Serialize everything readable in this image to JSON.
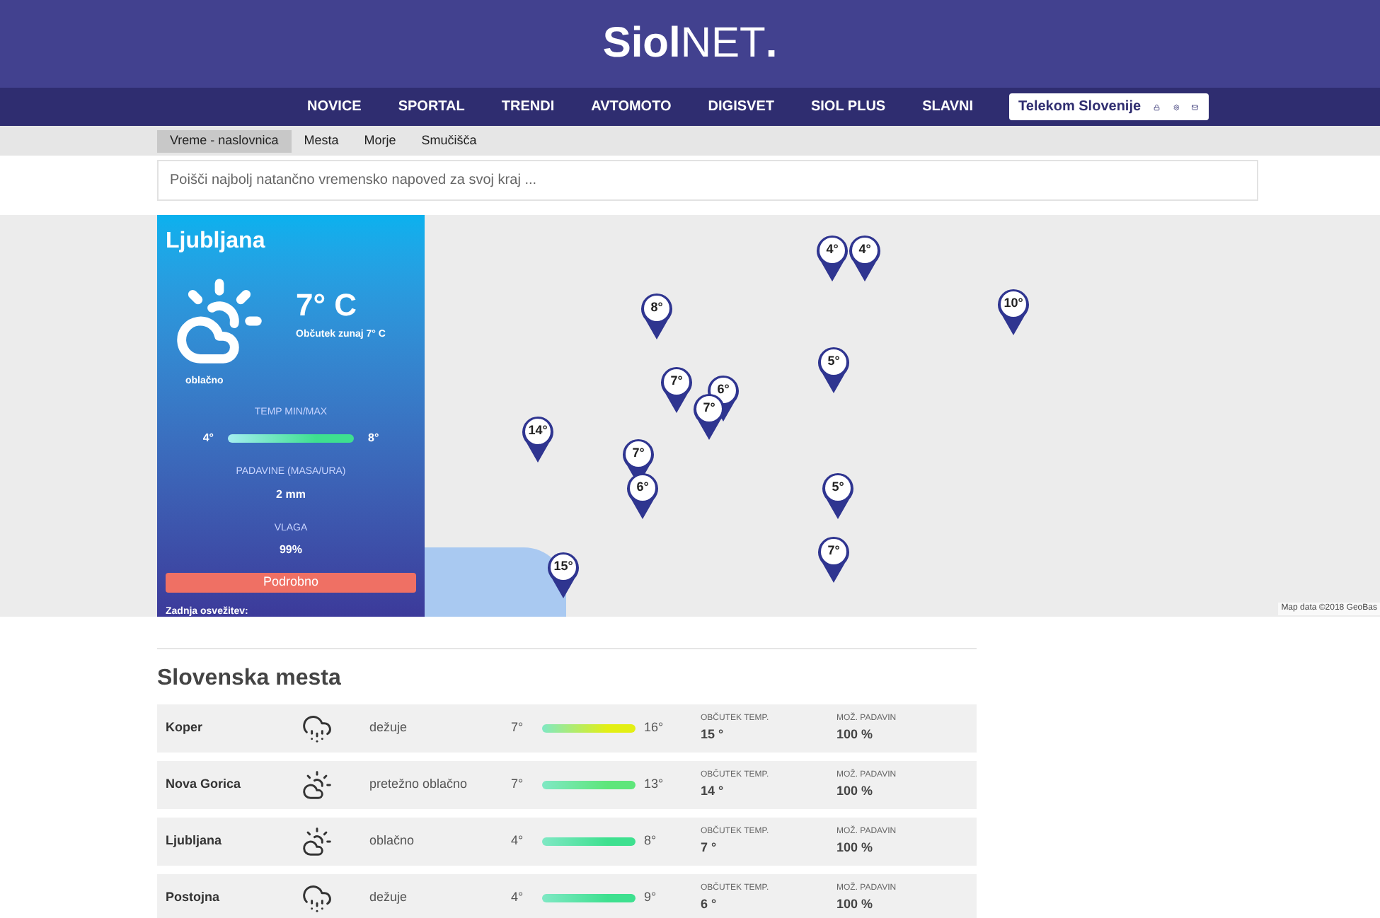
{
  "logo": {
    "bold": "Siol",
    "light": "NET",
    "dot": "."
  },
  "nav": [
    "NOVICE",
    "SPORTAL",
    "TRENDI",
    "AVTOMOTO",
    "DIGISVET",
    "SIOL PLUS",
    "SLAVNI"
  ],
  "account": {
    "label": "Telekom Slovenije"
  },
  "tabs": [
    {
      "label": "Vreme - naslovnica",
      "selected": true
    },
    {
      "label": "Mesta",
      "selected": false
    },
    {
      "label": "Morje",
      "selected": false
    },
    {
      "label": "Smučišča",
      "selected": false
    }
  ],
  "search": {
    "placeholder": "Poišči najbolj natančno vremensko napoved za svoj kraj ..."
  },
  "current": {
    "city": "Ljubljana",
    "temp": "7° C",
    "feels": "Občutek zunaj 7° C",
    "condition": "oblačno",
    "minmax_label": "TEMP MIN/MAX",
    "min": "4°",
    "max": "8°",
    "color": "#3ee08f",
    "rain_label": "PADAVINE (MASA/URA)",
    "rain": "2 mm",
    "humidity_label": "VLAGA",
    "humidity": "99%",
    "button": "Podrobno",
    "updated": "Zadnja osvežitev:"
  },
  "map": {
    "pins": [
      {
        "label": "4°"
      },
      {
        "label": "4°"
      },
      {
        "label": "8°"
      },
      {
        "label": "10°"
      },
      {
        "label": "5°"
      },
      {
        "label": "7°"
      },
      {
        "label": "6°"
      },
      {
        "label": "7°"
      },
      {
        "label": "14°"
      },
      {
        "label": "7°"
      },
      {
        "label": "6°"
      },
      {
        "label": "5°"
      },
      {
        "label": "7°"
      },
      {
        "label": "15°"
      }
    ],
    "attribution": "Map data ©2018 GeoBas"
  },
  "cities": {
    "title": "Slovenska mesta",
    "rows": [
      {
        "name": "Koper",
        "kind": "rain",
        "condition": "dežuje",
        "min": "7°",
        "max": "16°",
        "color": "#e3ef14",
        "feels_label": "OBČUTEK TEMP.",
        "feels": "15 °",
        "rain_label": "MOŽ. PADAVIN",
        "rain": "100 %"
      },
      {
        "name": "Nova Gorica",
        "kind": "partly_cloudy",
        "condition": "pretežno oblačno",
        "min": "7°",
        "max": "13°",
        "color": "#5ee67a",
        "feels_label": "OBČUTEK TEMP.",
        "feels": "14 °",
        "rain_label": "MOŽ. PADAVIN",
        "rain": "100 %"
      },
      {
        "name": "Ljubljana",
        "kind": "partly_cloudy",
        "condition": "oblačno",
        "min": "4°",
        "max": "8°",
        "color": "#3ee08f",
        "feels_label": "OBČUTEK TEMP.",
        "feels": "7 °",
        "rain_label": "MOŽ. PADAVIN",
        "rain": "100 %"
      },
      {
        "name": "Postojna",
        "kind": "rain",
        "condition": "dežuje",
        "min": "4°",
        "max": "9°",
        "color": "#3ee08f",
        "feels_label": "OBČUTEK TEMP.",
        "feels": "6 °",
        "rain_label": "MOŽ. PADAVIN",
        "rain": "100 %"
      }
    ]
  }
}
